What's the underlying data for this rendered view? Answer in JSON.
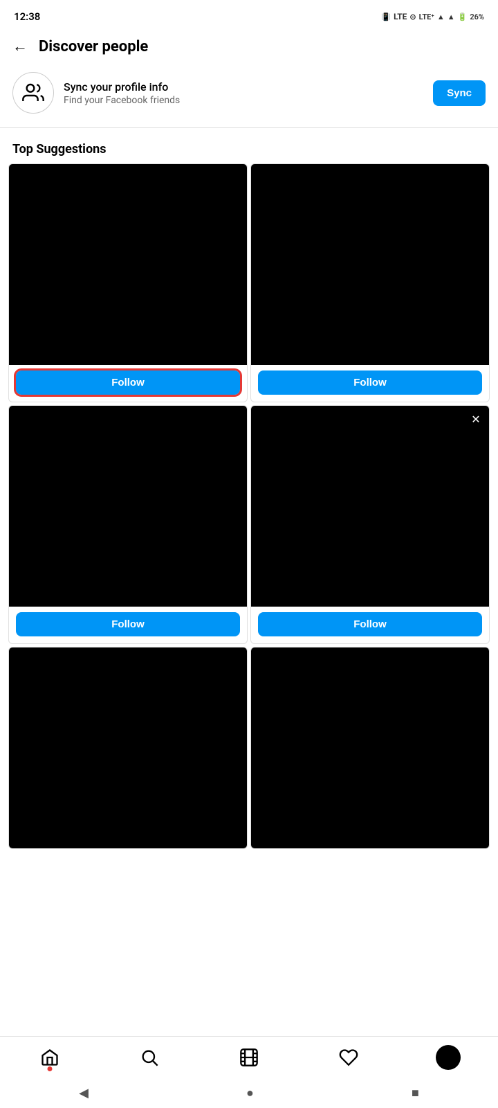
{
  "statusBar": {
    "time": "12:38",
    "battery": "26%",
    "signal": "LTE"
  },
  "header": {
    "backLabel": "←",
    "title": "Discover people"
  },
  "syncSection": {
    "title": "Sync your profile info",
    "subtitle": "Find your Facebook friends",
    "buttonLabel": "Sync"
  },
  "topSuggestions": {
    "sectionTitle": "Top Suggestions"
  },
  "cards": [
    {
      "id": "card-1",
      "highlighted": true,
      "hasClose": false,
      "followLabel": "Follow"
    },
    {
      "id": "card-2",
      "highlighted": false,
      "hasClose": false,
      "followLabel": "Follow"
    },
    {
      "id": "card-3",
      "highlighted": false,
      "hasClose": false,
      "followLabel": "Follow"
    },
    {
      "id": "card-4",
      "highlighted": false,
      "hasClose": true,
      "followLabel": "Follow"
    },
    {
      "id": "card-5",
      "highlighted": false,
      "hasClose": false,
      "followLabel": null
    },
    {
      "id": "card-6",
      "highlighted": false,
      "hasClose": false,
      "followLabel": null
    }
  ],
  "bottomNav": {
    "items": [
      {
        "name": "home",
        "label": "Home"
      },
      {
        "name": "search",
        "label": "Search"
      },
      {
        "name": "reels",
        "label": "Reels"
      },
      {
        "name": "activity",
        "label": "Activity"
      },
      {
        "name": "profile",
        "label": "Profile"
      }
    ]
  },
  "androidNav": {
    "back": "◀",
    "home": "●",
    "recents": "■"
  }
}
